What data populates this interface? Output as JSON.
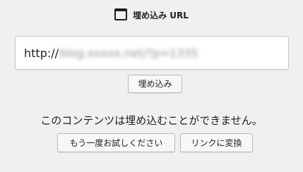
{
  "header": {
    "icon": "embed-icon",
    "title": "埋め込み URL"
  },
  "input": {
    "prefix": "http://",
    "rest_blurred": "blog.xxxxx.net/?p=1335"
  },
  "buttons": {
    "embed": "埋め込み",
    "retry": "もう一度お試しください",
    "convert_to_link": "リンクに変換"
  },
  "message": "このコンテンツは埋め込むことができません。"
}
